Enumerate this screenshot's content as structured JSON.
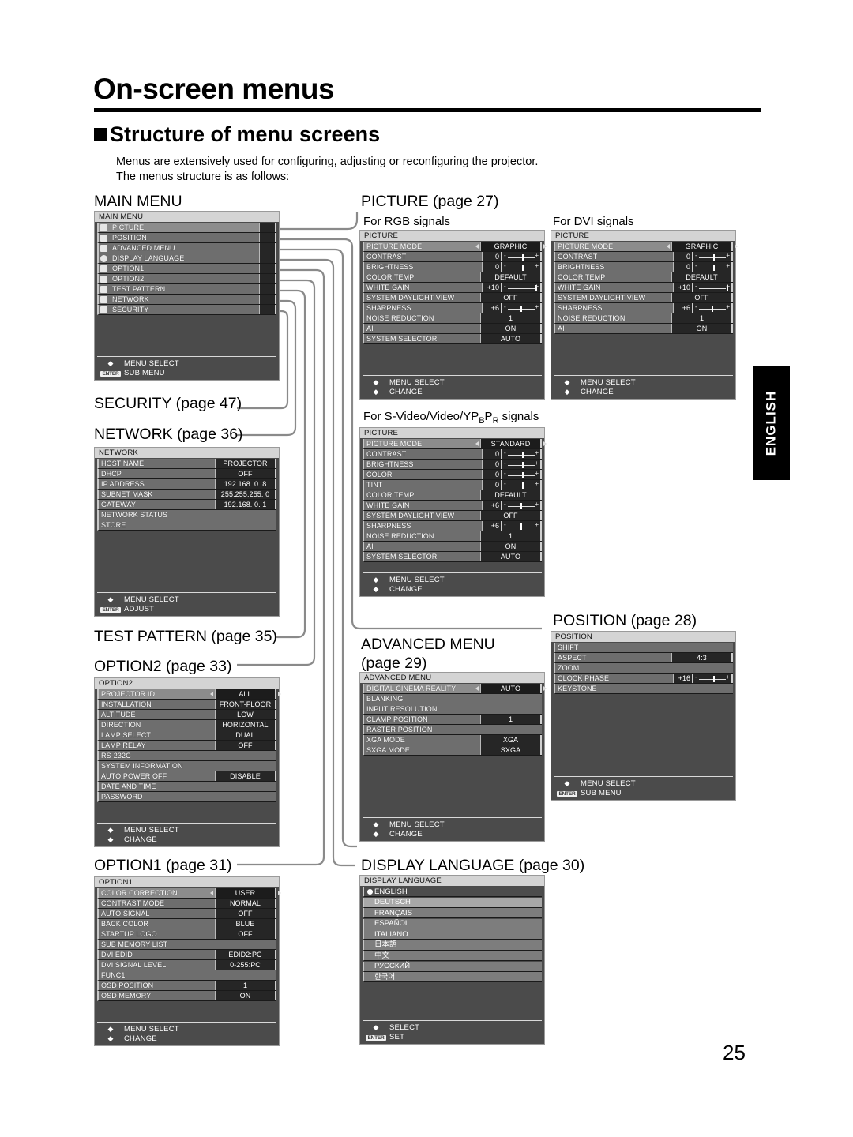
{
  "document": {
    "title": "On-screen menus",
    "section_bullet": "■",
    "section_title": "Structure of menu screens",
    "intro_line1": "Menus are extensively used for configuring, adjusting or reconfiguring the projector.",
    "intro_line2": "The menus structure is as follows:",
    "page_number": "25",
    "side_tab": "ENGLISH"
  },
  "captions": {
    "main_menu": "MAIN MENU",
    "picture": "PICTURE (page 27)",
    "picture_rgb": "For RGB signals",
    "picture_dvi": "For DVI signals",
    "picture_video": "For S-Video/Video/YPBPR signals",
    "security": "SECURITY (page 47)",
    "network": "NETWORK (page 36)",
    "test_pattern": "TEST PATTERN (page 35)",
    "option2": "OPTION2 (page 33)",
    "option1": "OPTION1 (page 31)",
    "advanced_menu_l1": "ADVANCED MENU",
    "advanced_menu_l2": "(page 29)",
    "position": "POSITION (page 28)",
    "display_language": "DISPLAY LANGUAGE (page 30)"
  },
  "footers": {
    "menu_select": "MENU SELECT",
    "sub_menu": "SUB MENU",
    "change": "CHANGE",
    "adjust": "ADJUST",
    "select": "SELECT",
    "set": "SET",
    "enter_badge": "ENTER",
    "updown_glyph": "◆",
    "leftright_glyph": "◆"
  },
  "main_menu": {
    "title": "MAIN MENU",
    "items": [
      {
        "label": "PICTURE",
        "icon": "picture-icon",
        "selected": true
      },
      {
        "label": "POSITION",
        "icon": "position-icon",
        "selected": false
      },
      {
        "label": "ADVANCED MENU",
        "icon": "advanced-menu-icon",
        "selected": false
      },
      {
        "label": "DISPLAY LANGUAGE",
        "icon": "globe-icon",
        "selected": false
      },
      {
        "label": "OPTION1",
        "icon": "option1-icon",
        "selected": false
      },
      {
        "label": "OPTION2",
        "icon": "option2-icon",
        "selected": false
      },
      {
        "label": "TEST PATTERN",
        "icon": "test-pattern-icon",
        "selected": false
      },
      {
        "label": "NETWORK",
        "icon": "network-icon",
        "selected": false
      },
      {
        "label": "SECURITY",
        "icon": "security-key-icon",
        "selected": false
      }
    ]
  },
  "picture_rgb": {
    "title": "PICTURE",
    "rows": [
      {
        "label": "PICTURE MODE",
        "value": "GRAPHIC",
        "type": "select"
      },
      {
        "label": "CONTRAST",
        "value": "0",
        "type": "slider",
        "knob": 50
      },
      {
        "label": "BRIGHTNESS",
        "value": "0",
        "type": "slider",
        "knob": 50
      },
      {
        "label": "COLOR TEMP",
        "value": "DEFAULT",
        "type": "value"
      },
      {
        "label": "WHITE GAIN",
        "value": "+10",
        "type": "slider",
        "knob": 92
      },
      {
        "label": "SYSTEM DAYLIGHT VIEW",
        "value": "OFF",
        "type": "value"
      },
      {
        "label": "SHARPNESS",
        "value": "+6",
        "type": "slider",
        "knob": 46
      },
      {
        "label": "NOISE REDUCTION",
        "value": "1",
        "type": "value"
      },
      {
        "label": "AI",
        "value": "ON",
        "type": "value"
      },
      {
        "label": "SYSTEM SELECTOR",
        "value": "AUTO",
        "type": "value"
      }
    ]
  },
  "picture_dvi": {
    "title": "PICTURE",
    "rows": [
      {
        "label": "PICTURE MODE",
        "value": "GRAPHIC",
        "type": "select"
      },
      {
        "label": "CONTRAST",
        "value": "0",
        "type": "slider",
        "knob": 50
      },
      {
        "label": "BRIGHTNESS",
        "value": "0",
        "type": "slider",
        "knob": 50
      },
      {
        "label": "COLOR TEMP",
        "value": "DEFAULT",
        "type": "value"
      },
      {
        "label": "WHITE GAIN",
        "value": "+10",
        "type": "slider",
        "knob": 92
      },
      {
        "label": "SYSTEM DAYLIGHT VIEW",
        "value": "OFF",
        "type": "value"
      },
      {
        "label": "SHARPNESS",
        "value": "+6",
        "type": "slider",
        "knob": 46
      },
      {
        "label": "NOISE REDUCTION",
        "value": "1",
        "type": "value"
      },
      {
        "label": "AI",
        "value": "ON",
        "type": "value"
      }
    ]
  },
  "picture_video": {
    "title": "PICTURE",
    "rows": [
      {
        "label": "PICTURE MODE",
        "value": "STANDARD",
        "type": "select"
      },
      {
        "label": "CONTRAST",
        "value": "0",
        "type": "slider",
        "knob": 50
      },
      {
        "label": "BRIGHTNESS",
        "value": "0",
        "type": "slider",
        "knob": 50
      },
      {
        "label": "COLOR",
        "value": "0",
        "type": "slider",
        "knob": 50
      },
      {
        "label": "TINT",
        "value": "0",
        "type": "slider",
        "knob": 50
      },
      {
        "label": "COLOR TEMP",
        "value": "DEFAULT",
        "type": "value"
      },
      {
        "label": "WHITE GAIN",
        "value": "+6",
        "type": "slider",
        "knob": 46
      },
      {
        "label": "SYSTEM DAYLIGHT VIEW",
        "value": "OFF",
        "type": "value"
      },
      {
        "label": "SHARPNESS",
        "value": "+6",
        "type": "slider",
        "knob": 46
      },
      {
        "label": "NOISE REDUCTION",
        "value": "1",
        "type": "value"
      },
      {
        "label": "AI",
        "value": "ON",
        "type": "value"
      },
      {
        "label": "SYSTEM SELECTOR",
        "value": "AUTO",
        "type": "value"
      }
    ]
  },
  "network": {
    "title": "NETWORK",
    "rows": [
      {
        "label": "HOST NAME",
        "value": "PROJECTOR",
        "type": "value"
      },
      {
        "label": "DHCP",
        "value": "OFF",
        "type": "value"
      },
      {
        "label": "IP ADDRESS",
        "value": "192.168.  0.  8",
        "type": "value"
      },
      {
        "label": "SUBNET MASK",
        "value": "255.255.255.  0",
        "type": "value"
      },
      {
        "label": "GATEWAY",
        "value": "192.168.  0.  1",
        "type": "value"
      },
      {
        "label": "NETWORK STATUS",
        "value": "",
        "type": "full"
      },
      {
        "label": "STORE",
        "value": "",
        "type": "full"
      }
    ]
  },
  "option2": {
    "title": "OPTION2",
    "rows": [
      {
        "label": "PROJECTOR ID",
        "value": "ALL",
        "type": "select"
      },
      {
        "label": "INSTALLATION",
        "value": "FRONT-FLOOR",
        "type": "value"
      },
      {
        "label": "ALTITUDE",
        "value": "LOW",
        "type": "value"
      },
      {
        "label": "DIRECTION",
        "value": "HORIZONTAL",
        "type": "value"
      },
      {
        "label": "LAMP SELECT",
        "value": "DUAL",
        "type": "value"
      },
      {
        "label": "LAMP RELAY",
        "value": "OFF",
        "type": "value"
      },
      {
        "label": "RS-232C",
        "value": "",
        "type": "full"
      },
      {
        "label": "SYSTEM INFORMATION",
        "value": "",
        "type": "full"
      },
      {
        "label": "AUTO POWER OFF",
        "value": "DISABLE",
        "type": "value"
      },
      {
        "label": "DATE AND TIME",
        "value": "",
        "type": "full"
      },
      {
        "label": "PASSWORD",
        "value": "",
        "type": "full"
      }
    ]
  },
  "option1": {
    "title": "OPTION1",
    "rows": [
      {
        "label": "COLOR CORRECTION",
        "value": "USER",
        "type": "select"
      },
      {
        "label": "CONTRAST MODE",
        "value": "NORMAL",
        "type": "value"
      },
      {
        "label": "AUTO SIGNAL",
        "value": "OFF",
        "type": "value"
      },
      {
        "label": "BACK COLOR",
        "value": "BLUE",
        "type": "value"
      },
      {
        "label": "STARTUP LOGO",
        "value": "OFF",
        "type": "value"
      },
      {
        "label": "SUB MEMORY LIST",
        "value": "",
        "type": "full"
      },
      {
        "label": "DVI EDID",
        "value": "EDID2:PC",
        "type": "value"
      },
      {
        "label": "DVI SIGNAL LEVEL",
        "value": "0-255:PC",
        "type": "value"
      },
      {
        "label": "FUNC1",
        "value": "",
        "type": "full"
      },
      {
        "label": "OSD POSITION",
        "value": "1",
        "type": "value"
      },
      {
        "label": "OSD MEMORY",
        "value": "ON",
        "type": "value"
      }
    ]
  },
  "advanced_menu": {
    "title": "ADVANCED MENU",
    "rows": [
      {
        "label": "DIGITAL CINEMA REALITY",
        "value": "AUTO",
        "type": "select"
      },
      {
        "label": "BLANKING",
        "value": "",
        "type": "full"
      },
      {
        "label": "INPUT RESOLUTION",
        "value": "",
        "type": "full"
      },
      {
        "label": "CLAMP POSITION",
        "value": "1",
        "type": "value"
      },
      {
        "label": "RASTER POSITION",
        "value": "",
        "type": "full"
      },
      {
        "label": "XGA MODE",
        "value": "XGA",
        "type": "value"
      },
      {
        "label": "SXGA MODE",
        "value": "SXGA",
        "type": "value"
      }
    ]
  },
  "position": {
    "title": "POSITION",
    "rows": [
      {
        "label": "SHIFT",
        "value": "",
        "type": "full"
      },
      {
        "label": "ASPECT",
        "value": "4:3",
        "type": "value"
      },
      {
        "label": "ZOOM",
        "value": "",
        "type": "full"
      },
      {
        "label": "CLOCK PHASE",
        "value": "+16",
        "type": "slider",
        "knob": 50
      },
      {
        "label": "KEYSTONE",
        "value": "",
        "type": "full"
      }
    ]
  },
  "display_language": {
    "title": "DISPLAY LANGUAGE",
    "options": [
      {
        "label": "ENGLISH",
        "selected": true,
        "cursor": false
      },
      {
        "label": "DEUTSCH",
        "selected": false,
        "cursor": true
      },
      {
        "label": "FRANÇAIS",
        "selected": false,
        "cursor": false
      },
      {
        "label": "ESPAÑOL",
        "selected": false,
        "cursor": false
      },
      {
        "label": "ITALIANO",
        "selected": false,
        "cursor": false
      },
      {
        "label": "日本語",
        "selected": false,
        "cursor": false
      },
      {
        "label": "中文",
        "selected": false,
        "cursor": false
      },
      {
        "label": "РУССКИЙ",
        "selected": false,
        "cursor": false
      },
      {
        "label": "한국어",
        "selected": false,
        "cursor": false
      }
    ]
  }
}
